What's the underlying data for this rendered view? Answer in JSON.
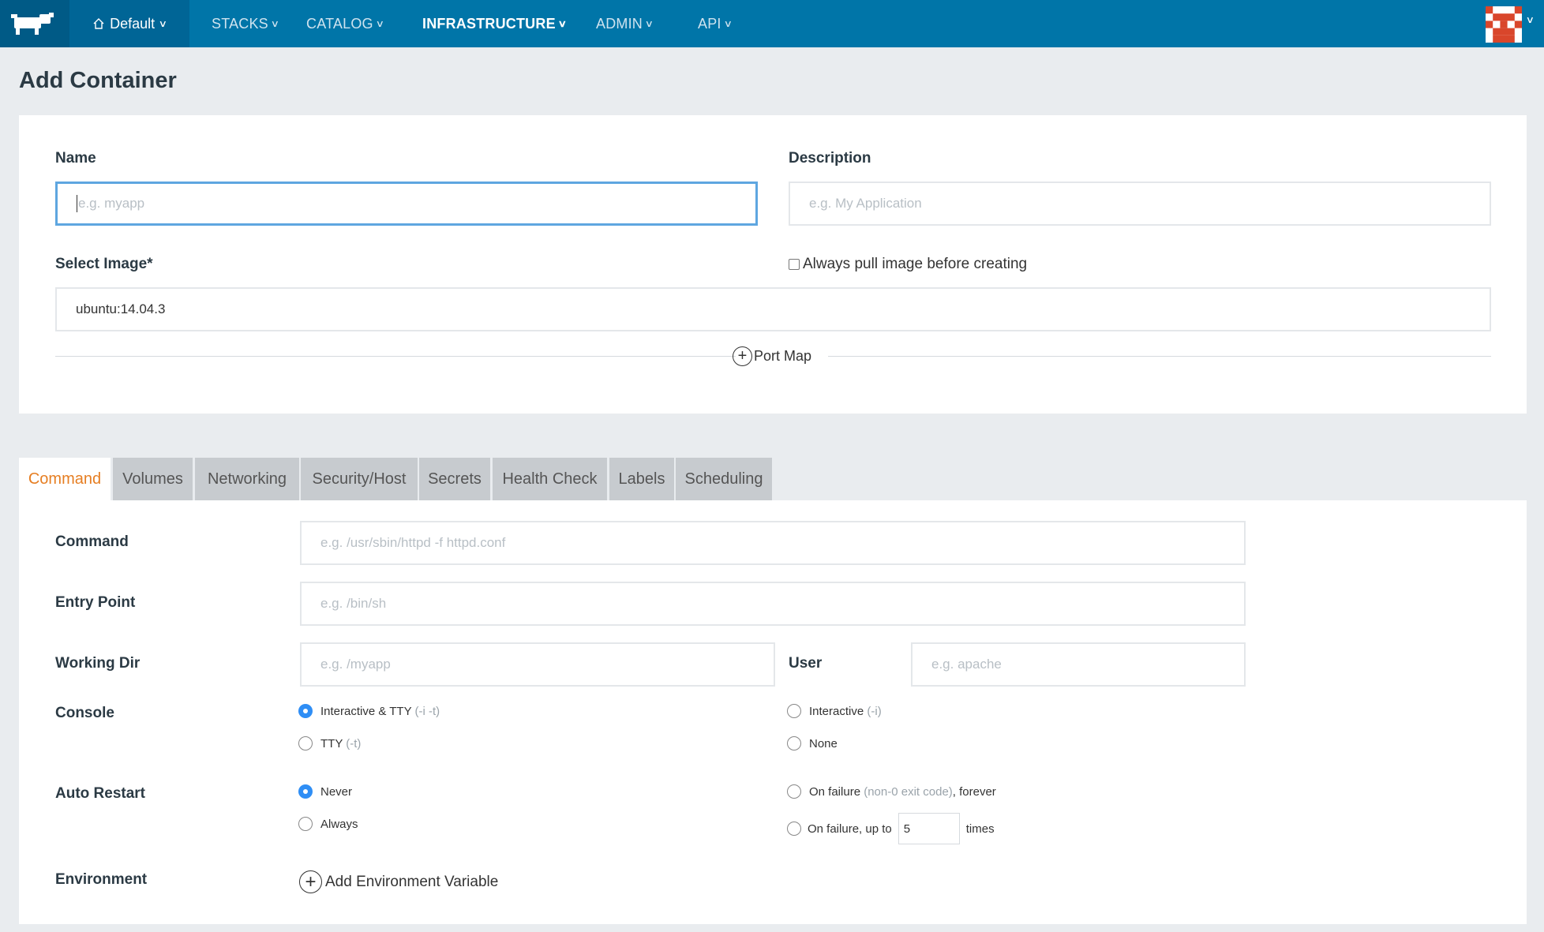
{
  "nav": {
    "environment": "Default",
    "items": [
      {
        "label": "STACKS"
      },
      {
        "label": "CATALOG"
      },
      {
        "label": "INFRASTRUCTURE"
      },
      {
        "label": "ADMIN"
      },
      {
        "label": "API"
      }
    ],
    "active": "INFRASTRUCTURE"
  },
  "page": {
    "title": "Add Container"
  },
  "form": {
    "name_label": "Name",
    "name_placeholder": "e.g. myapp",
    "description_label": "Description",
    "description_placeholder": "e.g. My Application",
    "image_label": "Select Image*",
    "image_value": "ubuntu:14.04.3",
    "always_pull_label": "Always pull image before creating",
    "port_map_label": "Port Map"
  },
  "tabs": [
    {
      "label": "Command",
      "active": true
    },
    {
      "label": "Volumes"
    },
    {
      "label": "Networking"
    },
    {
      "label": "Security/Host"
    },
    {
      "label": "Secrets"
    },
    {
      "label": "Health Check"
    },
    {
      "label": "Labels"
    },
    {
      "label": "Scheduling"
    }
  ],
  "command": {
    "command_label": "Command",
    "command_placeholder": "e.g. /usr/sbin/httpd -f httpd.conf",
    "entry_label": "Entry Point",
    "entry_placeholder": "e.g. /bin/sh",
    "workdir_label": "Working Dir",
    "workdir_placeholder": "e.g. /myapp",
    "user_label": "User",
    "user_placeholder": "e.g. apache",
    "console_label": "Console",
    "console_options": [
      {
        "label": "Interactive & TTY",
        "hint": "(-i -t)",
        "selected": true
      },
      {
        "label": "Interactive",
        "hint": "(-i)"
      },
      {
        "label": "TTY",
        "hint": "(-t)"
      },
      {
        "label": "None",
        "hint": ""
      }
    ],
    "restart_label": "Auto Restart",
    "restart_options": [
      {
        "label": "Never",
        "selected": true
      },
      {
        "label": "On failure",
        "hint": "(non-0 exit code)",
        "suffix": ", forever"
      },
      {
        "label": "Always"
      },
      {
        "label": "On failure, up to",
        "value": "5",
        "suffix": "times"
      }
    ],
    "environment_label": "Environment",
    "add_env_label": "Add Environment Variable"
  },
  "colors": {
    "nav_bg": "#0075a8",
    "accent_tab": "#e67e22",
    "radio_on": "#2f8ef5",
    "focus_border": "#5ea6e0"
  }
}
